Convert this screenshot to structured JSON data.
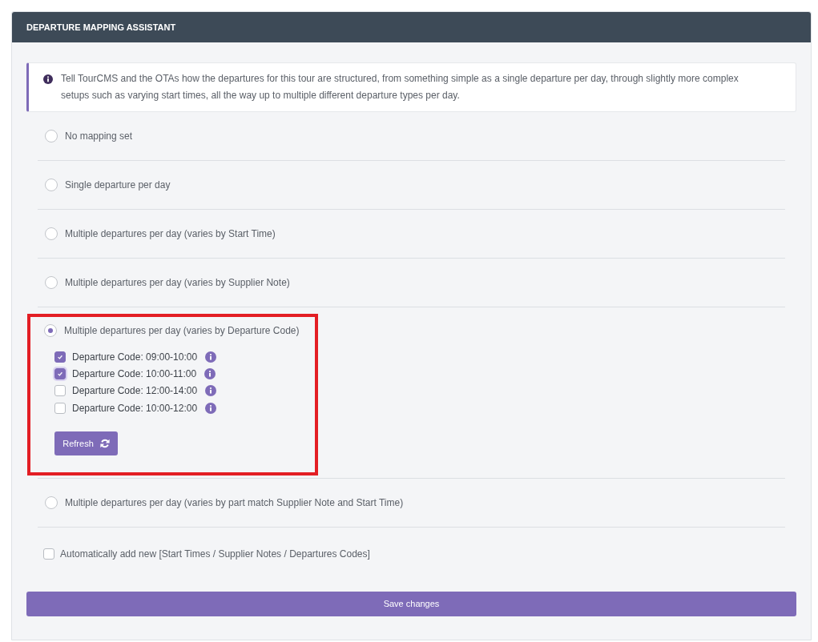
{
  "panel": {
    "title": "DEPARTURE MAPPING ASSISTANT"
  },
  "info": {
    "text": "Tell TourCMS and the OTAs how the departures for this tour are structured, from something simple as a single departure per day, through slightly more complex setups such as varying start times, all the way up to multiple different departure types per day."
  },
  "mapping_options": [
    {
      "label": "No mapping set",
      "selected": false,
      "highlighted": false
    },
    {
      "label": "Single departure per day",
      "selected": false,
      "highlighted": false
    },
    {
      "label": "Multiple departures per day (varies by Start Time)",
      "selected": false,
      "highlighted": false
    },
    {
      "label": "Multiple departures per day (varies by Supplier Note)",
      "selected": false,
      "highlighted": false
    },
    {
      "label": "Multiple departures per day (varies by Departure Code)",
      "selected": true,
      "highlighted": true,
      "departure_codes": [
        {
          "label": "Departure Code: 09:00-10:00",
          "checked": true,
          "focused": false
        },
        {
          "label": "Departure Code: 10:00-11:00",
          "checked": true,
          "focused": true
        },
        {
          "label": "Departure Code: 12:00-14:00",
          "checked": false,
          "focused": false
        },
        {
          "label": "Departure Code: 10:00-12:00",
          "checked": false,
          "focused": false
        }
      ],
      "refresh_button": "Refresh"
    },
    {
      "label": "Multiple departures per day (varies by part match Supplier Note and Start Time)",
      "selected": false,
      "highlighted": false
    }
  ],
  "auto_add": {
    "label": "Automatically add new [Start Times / Supplier Notes / Departures Codes]",
    "checked": false
  },
  "save_button": "Save changes"
}
